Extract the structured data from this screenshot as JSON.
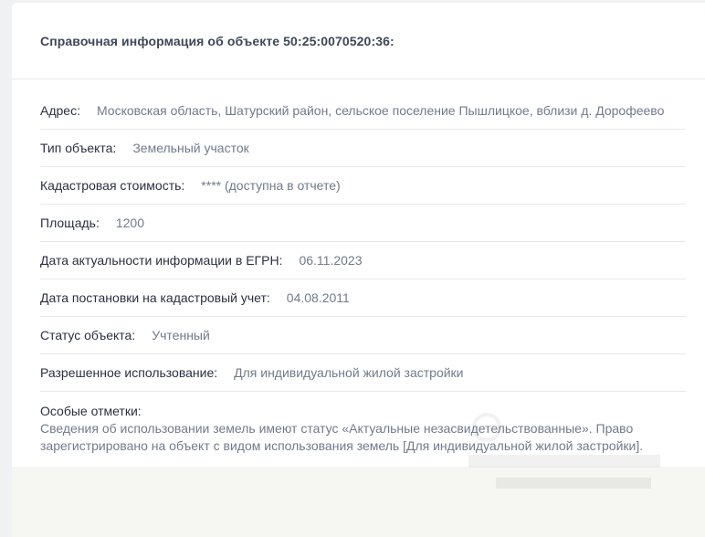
{
  "card": {
    "title": "Справочная информация об объекте 50:25:0070520:36:",
    "rows": [
      {
        "label": "Адрес:",
        "value": "Московская область, Шатурский район, сельское поселение Пышлицкое, вблизи д. Дорофеево"
      },
      {
        "label": "Тип объекта:",
        "value": "Земельный участок"
      },
      {
        "label": "Кадастровая стоимость:",
        "value": "**** (доступна в отчете)"
      },
      {
        "label": "Площадь:",
        "value": "1200"
      },
      {
        "label": "Дата актуальности информации в ЕГРН:",
        "value": "06.11.2023"
      },
      {
        "label": "Дата постановки на кадастровый учет:",
        "value": "04.08.2011"
      },
      {
        "label": "Статус объекта:",
        "value": "Учтенный"
      },
      {
        "label": "Разрешенное использование:",
        "value": "Для индивидуальной жилой застройки"
      }
    ],
    "notes": {
      "label": "Особые отметки:",
      "value": "Сведения об использовании земель имеют статус «Актуальные незасвидетельствованные». Право зарегистрировано на объект с видом использования земель [Для индивидуальной жилой застройки]."
    }
  },
  "colors": {
    "page_bg": "#f0f1f3",
    "card_bg": "#ffffff",
    "title": "#3f4759",
    "label": "#2b3040",
    "value": "#717a8c",
    "divider": "#e6e8ec"
  }
}
